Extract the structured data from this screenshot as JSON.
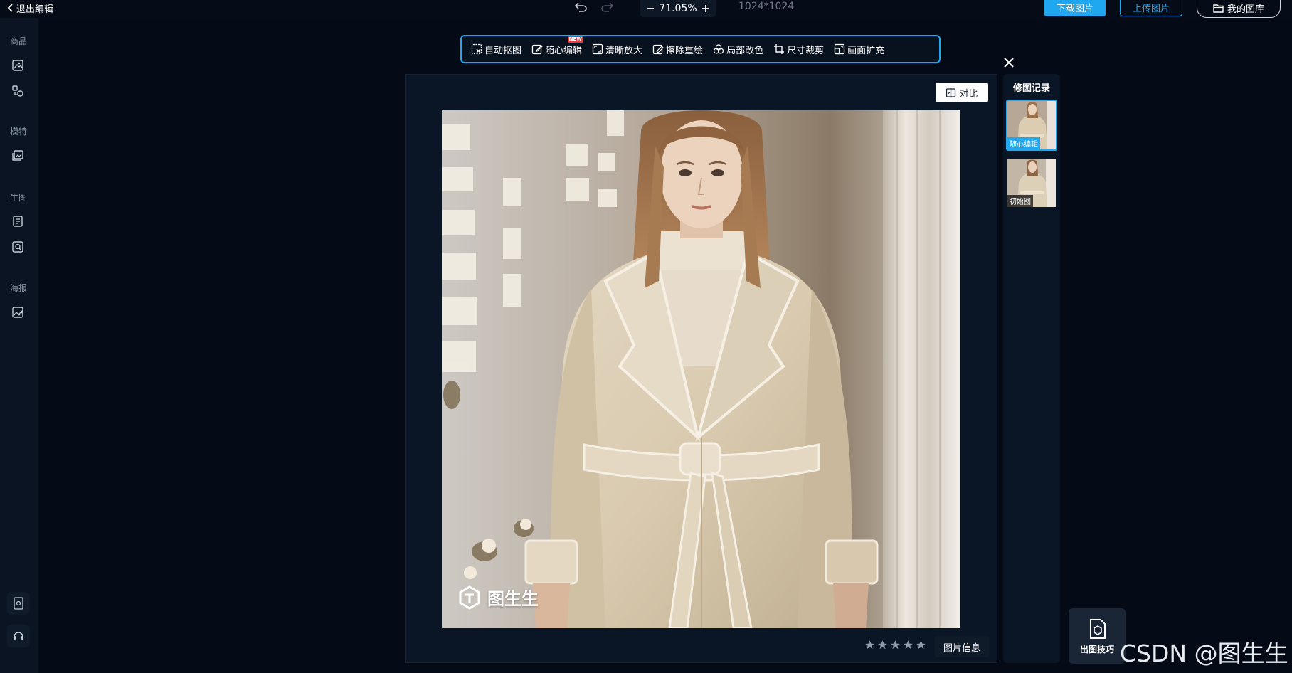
{
  "topbar": {
    "exit_label": "退出编辑",
    "zoom_value": "71.05%",
    "dimensions": "1024*1024",
    "download_label": "下载图片",
    "upload_label": "上传图片",
    "gallery_label": "我的图库"
  },
  "sidebar": {
    "sections": [
      "商品",
      "模特",
      "生图",
      "海报"
    ]
  },
  "toolbar": {
    "tools": [
      "自动抠图",
      "随心编辑",
      "清晰放大",
      "擦除重绘",
      "局部改色",
      "尺寸裁剪",
      "画面扩充"
    ],
    "new_badge": "NEW"
  },
  "canvas": {
    "compare_label": "对比",
    "watermark_text": "图生生",
    "rating": 0,
    "info_label": "图片信息"
  },
  "history": {
    "title": "修图记录",
    "items": [
      {
        "label": "随心编辑"
      },
      {
        "label": "初始图"
      }
    ]
  },
  "tips": {
    "label": "出图技巧"
  },
  "footer": {
    "credit": "CSDN @图生生"
  },
  "colors": {
    "accent": "#1fa8ef",
    "background": "#040b16"
  }
}
